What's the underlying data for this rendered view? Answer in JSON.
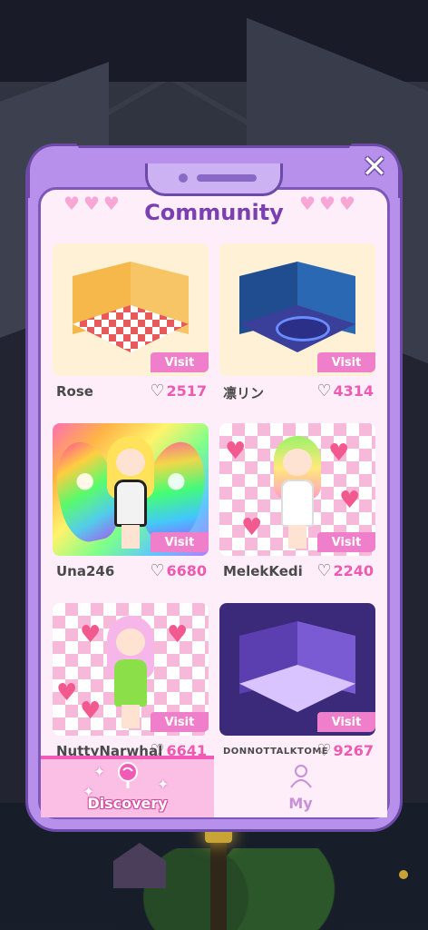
{
  "dialog": {
    "title": "Community",
    "close_label": "✕"
  },
  "cards": [
    {
      "name": "Rose",
      "likes": "2517",
      "visit_label": "Visit"
    },
    {
      "name": "凛リン",
      "likes": "4314",
      "visit_label": "Visit"
    },
    {
      "name": "Una246",
      "likes": "6680",
      "visit_label": "Visit"
    },
    {
      "name": "MelekKedi",
      "likes": "2240",
      "visit_label": "Visit"
    },
    {
      "name": "NuttyNarwhal",
      "likes": "6641",
      "visit_label": "Visit"
    },
    {
      "name": "DONNOTTALKTOME",
      "likes": "9267",
      "visit_label": "Visit"
    }
  ],
  "tabs": [
    {
      "label": "Discovery",
      "icon": "lollipop-icon",
      "active": true
    },
    {
      "label": "My",
      "icon": "person-icon",
      "active": false
    }
  ],
  "colors": {
    "frame": "#b690ea",
    "panel": "#fdeefa",
    "title": "#7a3fb0",
    "accent_pink": "#f07fcb",
    "like_count": "#ee5aaf"
  }
}
